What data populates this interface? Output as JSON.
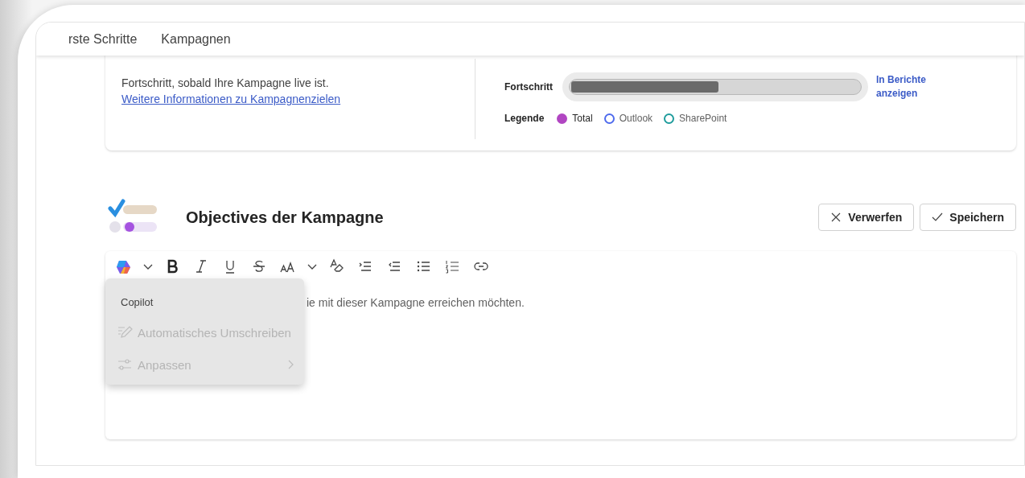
{
  "nav": {
    "tabs": [
      {
        "label": "rste Schritte",
        "selected": false
      },
      {
        "label": "Kampagnen",
        "selected": false
      }
    ]
  },
  "goal_card": {
    "description": "Fortschritt, sobald Ihre Kampagne live ist. ",
    "link": "Weitere Informationen zu Kampagnenzielen",
    "progress_label": "Fortschritt",
    "progress": {
      "level": 0.51
    },
    "report_link": "In Berichte anzeigen",
    "legend_label": "Legende",
    "legend": [
      {
        "label": "Total",
        "color": "#b146c2",
        "filled": true
      },
      {
        "label": "Outlook",
        "color": "#4f6bed",
        "filled": false
      },
      {
        "label": "SharePoint",
        "color": "#1f9c9c",
        "filled": false
      }
    ]
  },
  "objectives": {
    "title": "Objectives der Kampagne",
    "buttons": [
      {
        "kind": "discard",
        "label": "Verwerfen"
      },
      {
        "kind": "save",
        "label": "Speichern"
      }
    ],
    "placeholder": "ie mit dieser Kampagne erreichen möchten.",
    "menu": {
      "header": "Copilot",
      "items": [
        {
          "kind": "rewrite",
          "label": "Automatisches Umschreiben",
          "disabled": true,
          "submenu": false
        },
        {
          "kind": "adjust",
          "label": "Anpassen",
          "disabled": true,
          "submenu": true
        }
      ]
    }
  }
}
